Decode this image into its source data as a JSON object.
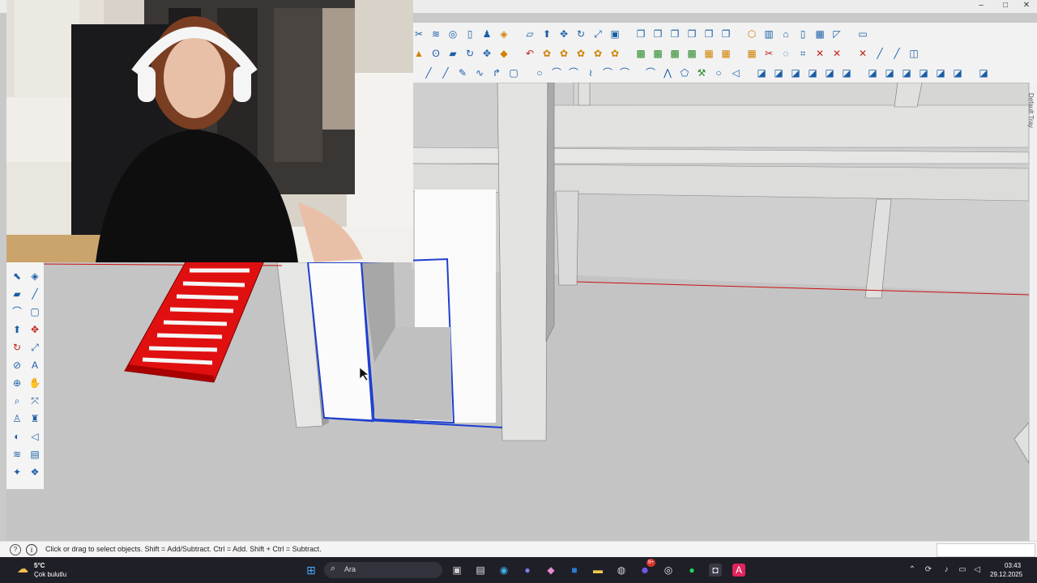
{
  "window": {
    "controls": {
      "minimize": "–",
      "maximize": "□",
      "close": "✕"
    }
  },
  "toolbars": {
    "row1_icons": [
      "knife-icon",
      "layers-icon",
      "target-icon",
      "new-file-icon",
      "user-icon",
      "paint-icon",
      "ruler-icon",
      "push-pull-icon",
      "move-icon",
      "rotate-icon",
      "scale-icon",
      "offset-icon",
      "copy-icon",
      "copy-icon",
      "copy-icon",
      "copy-icon",
      "copy-icon",
      "copy-icon",
      "cube-icon",
      "wall-icon",
      "house-icon",
      "door-icon",
      "window-icon",
      "roof-icon",
      "stair-icon"
    ],
    "row2_icons": [
      "warning-icon",
      "lasso-icon",
      "eraser-icon",
      "rotate-icon",
      "move-icon",
      "bucket-icon",
      "undo-icon",
      "plugin-icon",
      "plugin-icon",
      "plugin-icon",
      "plugin-icon",
      "plugin-icon",
      "component-icon",
      "component-icon",
      "component-icon",
      "component-icon",
      "grid-icon",
      "grid-icon",
      "grid-icon",
      "scissors-icon",
      "circle-dash-icon",
      "crop-icon",
      "crossing-icon",
      "crossing-icon",
      "crossing-icon",
      "line-icon",
      "line-icon",
      "square-icon"
    ],
    "row3_icons": [
      "line-icon",
      "line-icon",
      "pencil-icon",
      "wave-icon",
      "curve-icon",
      "rectangle-icon",
      "circle-icon",
      "arc-icon",
      "arc-icon",
      "zigzag-icon",
      "arc-icon",
      "arc-icon",
      "arc-icon",
      "polyline-icon",
      "polygon-icon",
      "wrench-icon",
      "circle-icon",
      "arrow-icon",
      "view-icon",
      "view-icon",
      "view-icon",
      "view-icon",
      "view-icon",
      "view-icon",
      "view-icon",
      "view-icon",
      "view-icon",
      "view-icon",
      "view-icon",
      "view-icon",
      "view-icon"
    ]
  },
  "left_toolbar": {
    "tools": [
      "select-icon",
      "paint-bucket-icon",
      "eraser-icon",
      "line-icon",
      "arc-icon",
      "rectangle-icon",
      "push-pull-icon",
      "move-icon",
      "rotate-icon",
      "scale-icon",
      "tape-measure-icon",
      "text-icon",
      "orbit-icon",
      "pan-icon",
      "zoom-icon",
      "zoom-extents-icon",
      "walk-icon",
      "position-camera-icon",
      "look-around-icon",
      "section-plane-icon",
      "layers-icon",
      "scenes-icon",
      "styles-icon",
      "components-icon"
    ]
  },
  "tray": {
    "label": "Default Tray"
  },
  "status": {
    "message": "Click or drag to select objects. Shift = Add/Subtract. Ctrl = Add. Shift + Ctrl = Subtract.",
    "help_icon": "help-icon",
    "info_icon": "info-icon"
  },
  "taskbar": {
    "weather_temp": "5°C",
    "weather_desc": "Çok bulutlu",
    "search_placeholder": "Ara",
    "time": "03:43",
    "date": "29.12.2025",
    "badge": "9+"
  },
  "colors": {
    "accent_blue": "#1e3fcf",
    "stair_red": "#e01010",
    "axis_red": "#cc1010",
    "model_gray": "#c8c8c8"
  }
}
